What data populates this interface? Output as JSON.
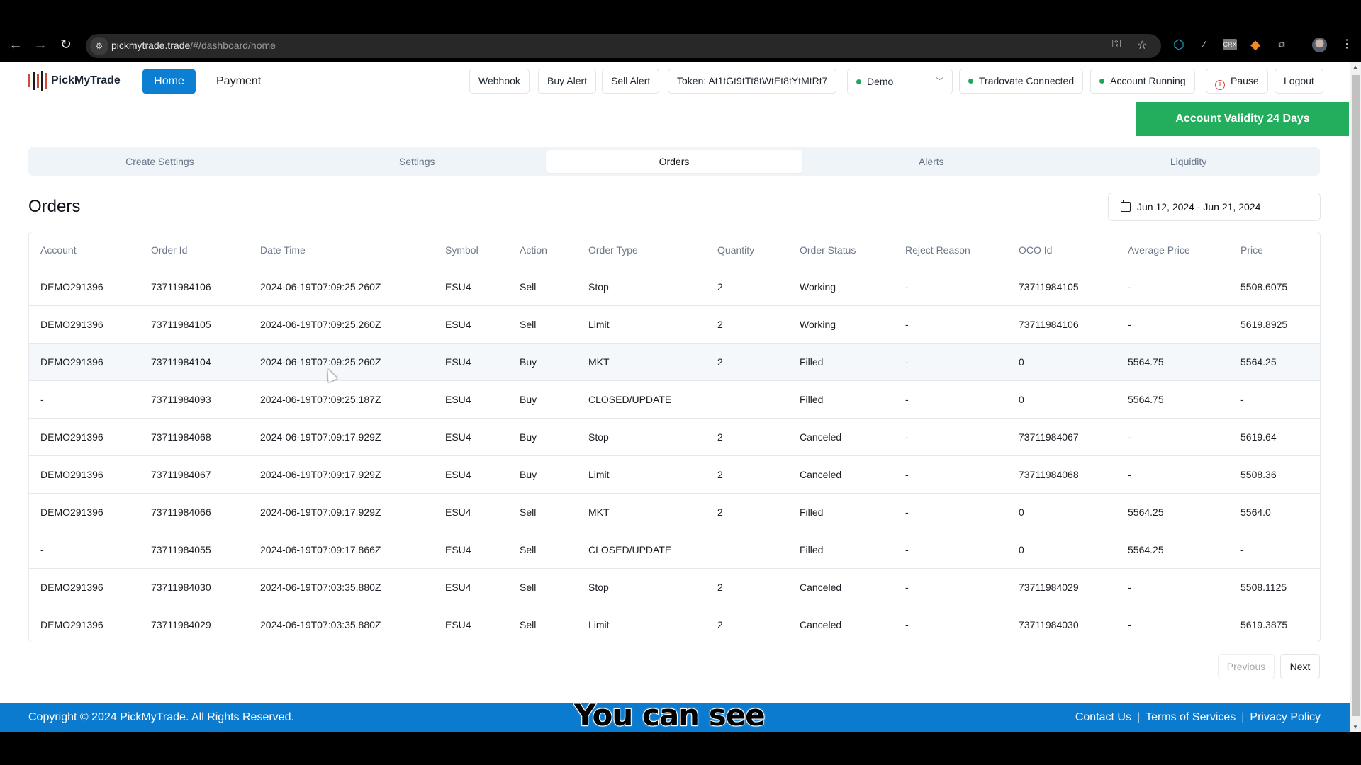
{
  "browser": {
    "url_host": "pickmytrade.trade",
    "url_path": "/#/dashboard/home",
    "icons": [
      "back-icon",
      "forward-icon",
      "reload-icon",
      "site-info-icon",
      "key-icon",
      "star-icon",
      "extension-web-icon",
      "extension-brush-icon",
      "extension-crx-icon",
      "extension-fox-icon",
      "extensions-puzzle-icon",
      "profile-avatar",
      "menu-kebab-icon"
    ],
    "crx_label": "CRX"
  },
  "header": {
    "brand": "PickMyTrade",
    "nav": {
      "home": "Home",
      "payment": "Payment"
    },
    "buttons": {
      "webhook": "Webhook",
      "buy_alert": "Buy Alert",
      "sell_alert": "Sell Alert",
      "token": "Token: At1tGt9tTt8tWtEt8tYtMtRt7",
      "tradovate": "Tradovate Connected",
      "account_running": "Account Running",
      "pause": "Pause",
      "logout": "Logout"
    },
    "account_select": {
      "selected": "Demo"
    },
    "status_colors": {
      "connected": "#1fa85d",
      "pause": "#d9463a"
    }
  },
  "validity_banner": "Account Validity 24 Days",
  "tabs": [
    {
      "label": "Create Settings",
      "active": false
    },
    {
      "label": "Settings",
      "active": false
    },
    {
      "label": "Orders",
      "active": true
    },
    {
      "label": "Alerts",
      "active": false
    },
    {
      "label": "Liquidity",
      "active": false
    }
  ],
  "orders": {
    "title": "Orders",
    "date_range": "Jun 12, 2024 - Jun 21, 2024",
    "columns": [
      "Account",
      "Order Id",
      "Date Time",
      "Symbol",
      "Action",
      "Order Type",
      "Quantity",
      "Order Status",
      "Reject Reason",
      "OCO Id",
      "Average Price",
      "Price"
    ],
    "rows": [
      [
        "DEMO291396",
        "73711984106",
        "2024-06-19T07:09:25.260Z",
        "ESU4",
        "Sell",
        "Stop",
        "2",
        "Working",
        "-",
        "73711984105",
        "-",
        "5508.6075"
      ],
      [
        "DEMO291396",
        "73711984105",
        "2024-06-19T07:09:25.260Z",
        "ESU4",
        "Sell",
        "Limit",
        "2",
        "Working",
        "-",
        "73711984106",
        "-",
        "5619.8925"
      ],
      [
        "DEMO291396",
        "73711984104",
        "2024-06-19T07:09:25.260Z",
        "ESU4",
        "Buy",
        "MKT",
        "2",
        "Filled",
        "-",
        "0",
        "5564.75",
        "5564.25"
      ],
      [
        "-",
        "73711984093",
        "2024-06-19T07:09:25.187Z",
        "ESU4",
        "Buy",
        "CLOSED/UPDATE",
        "",
        "Filled",
        "-",
        "0",
        "5564.75",
        "-"
      ],
      [
        "DEMO291396",
        "73711984068",
        "2024-06-19T07:09:17.929Z",
        "ESU4",
        "Buy",
        "Stop",
        "2",
        "Canceled",
        "-",
        "73711984067",
        "-",
        "5619.64"
      ],
      [
        "DEMO291396",
        "73711984067",
        "2024-06-19T07:09:17.929Z",
        "ESU4",
        "Buy",
        "Limit",
        "2",
        "Canceled",
        "-",
        "73711984068",
        "-",
        "5508.36"
      ],
      [
        "DEMO291396",
        "73711984066",
        "2024-06-19T07:09:17.929Z",
        "ESU4",
        "Sell",
        "MKT",
        "2",
        "Filled",
        "-",
        "0",
        "5564.25",
        "5564.0"
      ],
      [
        "-",
        "73711984055",
        "2024-06-19T07:09:17.866Z",
        "ESU4",
        "Sell",
        "CLOSED/UPDATE",
        "",
        "Filled",
        "-",
        "0",
        "5564.25",
        "-"
      ],
      [
        "DEMO291396",
        "73711984030",
        "2024-06-19T07:03:35.880Z",
        "ESU4",
        "Sell",
        "Stop",
        "2",
        "Canceled",
        "-",
        "73711984029",
        "-",
        "5508.1125"
      ],
      [
        "DEMO291396",
        "73711984029",
        "2024-06-19T07:03:35.880Z",
        "ESU4",
        "Sell",
        "Limit",
        "2",
        "Canceled",
        "-",
        "73711984030",
        "-",
        "5619.3875"
      ]
    ],
    "hovered_row": 2,
    "pagination": {
      "previous": "Previous",
      "next": "Next"
    }
  },
  "footer": {
    "copyright": "Copyright © 2024 PickMyTrade. All Rights Reserved.",
    "links": [
      "Contact Us",
      "Terms of Services",
      "Privacy Policy"
    ]
  },
  "video_caption": "You can see",
  "colors": {
    "primary": "#0d7fd3",
    "footer": "#0a7bcf",
    "validity": "#22ae5d"
  }
}
